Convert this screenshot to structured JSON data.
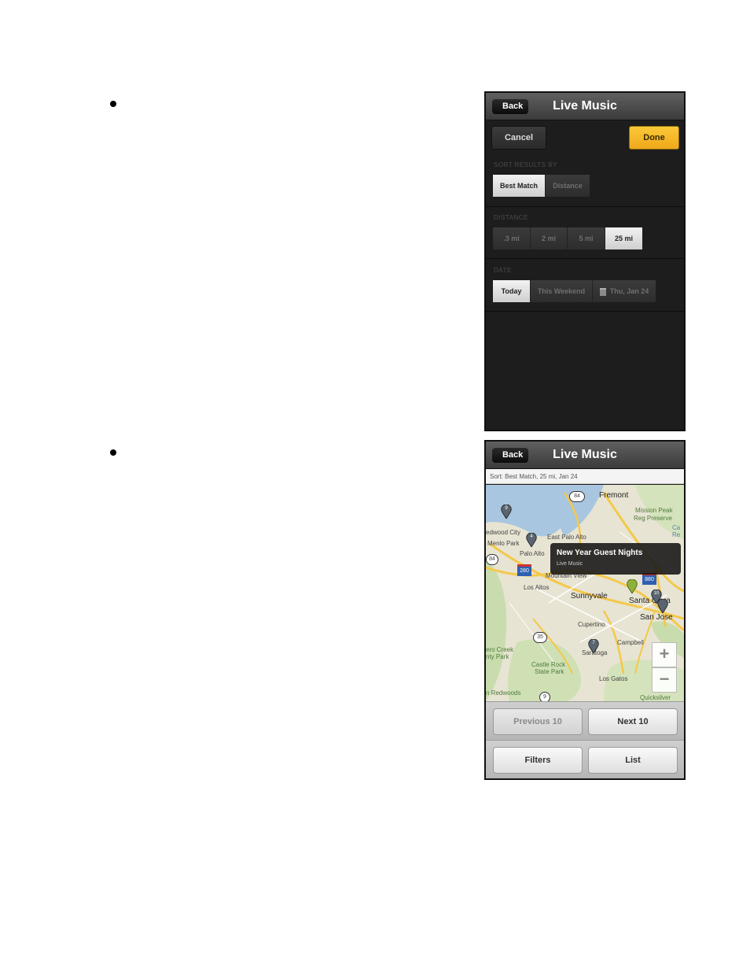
{
  "screen_filters": {
    "back_label": "Back",
    "title": "Live Music",
    "cancel_label": "Cancel",
    "done_label": "Done",
    "sort": {
      "label": "SORT RESULTS BY",
      "options": [
        "Best Match",
        "Distance"
      ],
      "selected": "Best Match"
    },
    "distance": {
      "label": "DISTANCE",
      "options": [
        ".3 mi",
        "2 mi",
        "5 mi",
        "25 mi"
      ],
      "selected": "25 mi"
    },
    "date": {
      "label": "DATE",
      "options": [
        "Today",
        "This Weekend",
        "Thu, Jan 24"
      ],
      "selected": "Today",
      "calendar_icon": "calendar-icon"
    }
  },
  "screen_map": {
    "back_label": "Back",
    "title": "Live Music",
    "sort_summary": "Sort: Best Match, 25 mi, Jan 24",
    "callout": {
      "title": "New Year Guest Nights",
      "subtitle": "Live Music"
    },
    "map_labels": {
      "fremont": "Fremont",
      "mission_peak": "Mission Peak",
      "reg_preserve": "Reg Preserve",
      "redwood_city": "edwood City",
      "menlo_park": "Menlo Park",
      "east_palo_alto": "East Palo Alto",
      "palo_alto": "Palo Alto",
      "mountain_view": "Mountain View",
      "los_altos": "Los Altos",
      "sunnyvale": "Sunnyvale",
      "santa_clara": "Santa Clara",
      "san_jose": "San Jose",
      "cupertino": "Cupertino",
      "campbell": "Campbell",
      "saratoga": "Saratoga",
      "castle_rock": "Castle Rock",
      "state_park": "State Park",
      "los_gatos": "Los Gatos",
      "pero_creek": "ero Creek",
      "county_park": "nty Park",
      "redwoods": "n Redwoods",
      "quicksilver": "Quicksilver",
      "shield_84": "84",
      "shield_280": "280",
      "shield_880": "880",
      "shield_35": "35",
      "shield_9": "9",
      "shield_84b": "84",
      "ca": "Ca",
      "re": "Re"
    },
    "pin_numbers": [
      "9",
      "4",
      "10",
      "7"
    ],
    "zoom_in": "+",
    "zoom_out": "−",
    "previous_label": "Previous 10",
    "next_label": "Next 10",
    "filters_label": "Filters",
    "list_label": "List"
  }
}
